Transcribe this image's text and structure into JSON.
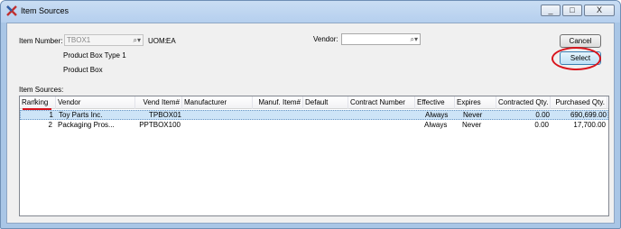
{
  "window": {
    "title": "Item Sources",
    "controls": {
      "minimize": "_",
      "maximize": "□",
      "close": "X"
    }
  },
  "form": {
    "item_number_label": "Item Number:",
    "item_number_value": "TBOX1",
    "uom_label": "UOM:",
    "uom_value": "EA",
    "description_line1": "Product Box Type 1",
    "description_line2": "Product Box",
    "vendor_label": "Vendor:",
    "vendor_value": "",
    "item_sources_label": "Item Sources:"
  },
  "buttons": {
    "cancel": "Cancel",
    "select": "Select"
  },
  "grid": {
    "columns": [
      "Ranking",
      "Vendor",
      "Vend Item#",
      "Manufacturer",
      "Manuf. Item#",
      "Default",
      "Contract Number",
      "Effective",
      "Expires",
      "Contracted Qty.",
      "Purchased Qty."
    ],
    "rows": [
      {
        "ranking": "1",
        "vendor": "Toy Parts Inc.",
        "vend_item": "TPBOX01",
        "manufacturer": "",
        "manuf_item": "",
        "default": "",
        "contract_number": "",
        "effective": "Always",
        "expires": "Never",
        "contracted_qty": "0.00",
        "purchased_qty": "690,699.00"
      },
      {
        "ranking": "2",
        "vendor": "Packaging Pros...",
        "vend_item": "PPTBOX100",
        "manufacturer": "",
        "manuf_item": "",
        "default": "",
        "contract_number": "",
        "effective": "Always",
        "expires": "Never",
        "contracted_qty": "0.00",
        "purchased_qty": "17,700.00"
      }
    ]
  },
  "icons": {
    "app": "x-logo-icon",
    "lookup": "magnifier-dropdown-icon"
  },
  "colors": {
    "highlight_ring": "#d8141c",
    "selected_row": "#cde4f7"
  }
}
